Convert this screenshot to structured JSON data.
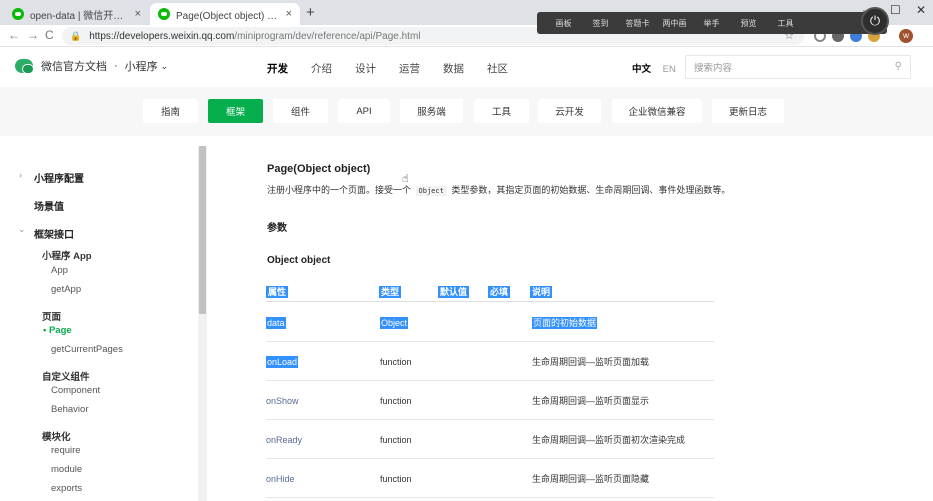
{
  "browser": {
    "tabs": [
      {
        "title": "open-data | 微信开放文档",
        "close": "×"
      },
      {
        "title": "Page(Object object) | 微信开放文",
        "close": "×"
      }
    ],
    "new_tab": "+",
    "window_controls": [
      "—",
      "☐",
      "✕"
    ],
    "url_host": "https://developers.weixin.qq.com",
    "url_path": "/miniprogram/dev/reference/api/Page.html",
    "nav": {
      "back": "←",
      "forward": "→",
      "reload": "C"
    },
    "lock": "🔒",
    "star": "☆",
    "profile_initial": "w"
  },
  "floating_toolbar": {
    "items": [
      "画板",
      "签到",
      "答题卡",
      "两中画",
      "举手",
      "预览",
      "工具"
    ]
  },
  "site": {
    "brand": "微信官方文档",
    "dot": "·",
    "product": "小程序",
    "nav": [
      "开发",
      "介绍",
      "设计",
      "运营",
      "数据",
      "社区"
    ],
    "lang_zh": "中文",
    "lang_en": "EN",
    "search_placeholder": "搜索内容"
  },
  "subnav": [
    "指南",
    "框架",
    "组件",
    "API",
    "服务端",
    "工具",
    "云开发",
    "企业微信兼容",
    "更新日志"
  ],
  "sidebar": {
    "items": [
      {
        "label": "小程序配置",
        "level": "l1",
        "chev": "›"
      },
      {
        "label": "场景值",
        "level": "l1"
      },
      {
        "label": "框架接口",
        "level": "l1",
        "chev": "⌄"
      },
      {
        "label": "小程序 App",
        "level": "l2"
      },
      {
        "label": "App",
        "level": "l3"
      },
      {
        "label": "getApp",
        "level": "l3"
      },
      {
        "label": "页面",
        "level": "l2"
      },
      {
        "label": "• Page",
        "level": "cur"
      },
      {
        "label": "getCurrentPages",
        "level": "l3"
      },
      {
        "label": "自定义组件",
        "level": "l2"
      },
      {
        "label": "Component",
        "level": "l3"
      },
      {
        "label": "Behavior",
        "level": "l3"
      },
      {
        "label": "模块化",
        "level": "l2"
      },
      {
        "label": "require",
        "level": "l3"
      },
      {
        "label": "module",
        "level": "l3"
      },
      {
        "label": "exports",
        "level": "l3"
      }
    ]
  },
  "content": {
    "title": "Page(Object object)",
    "desc_before": "注册小程序中的一个页面。接受一个",
    "desc_code": "Object",
    "desc_after": "类型参数，其指定页面的初始数据、生命周期回调、事件处理函数等。",
    "section_params": "参数",
    "section_object": "Object object",
    "table_headers": [
      "属性",
      "类型",
      "默认值",
      "必填",
      "说明"
    ],
    "rows": [
      {
        "name": "data",
        "type": "Object",
        "note": "页面的初始数据"
      },
      {
        "name": "onLoad",
        "type": "function",
        "note": "生命周期回调—监听页面加载"
      },
      {
        "name": "onShow",
        "type": "function",
        "note": "生命周期回调—监听页面显示"
      },
      {
        "name": "onReady",
        "type": "function",
        "note": "生命周期回调—监听页面初次渲染完成"
      },
      {
        "name": "onHide",
        "type": "function",
        "note": "生命周期回调—监听页面隐藏"
      }
    ]
  },
  "colors": {
    "brand_green": "#07ae4d",
    "selection_blue": "#3390ff",
    "link": "#576b95"
  }
}
